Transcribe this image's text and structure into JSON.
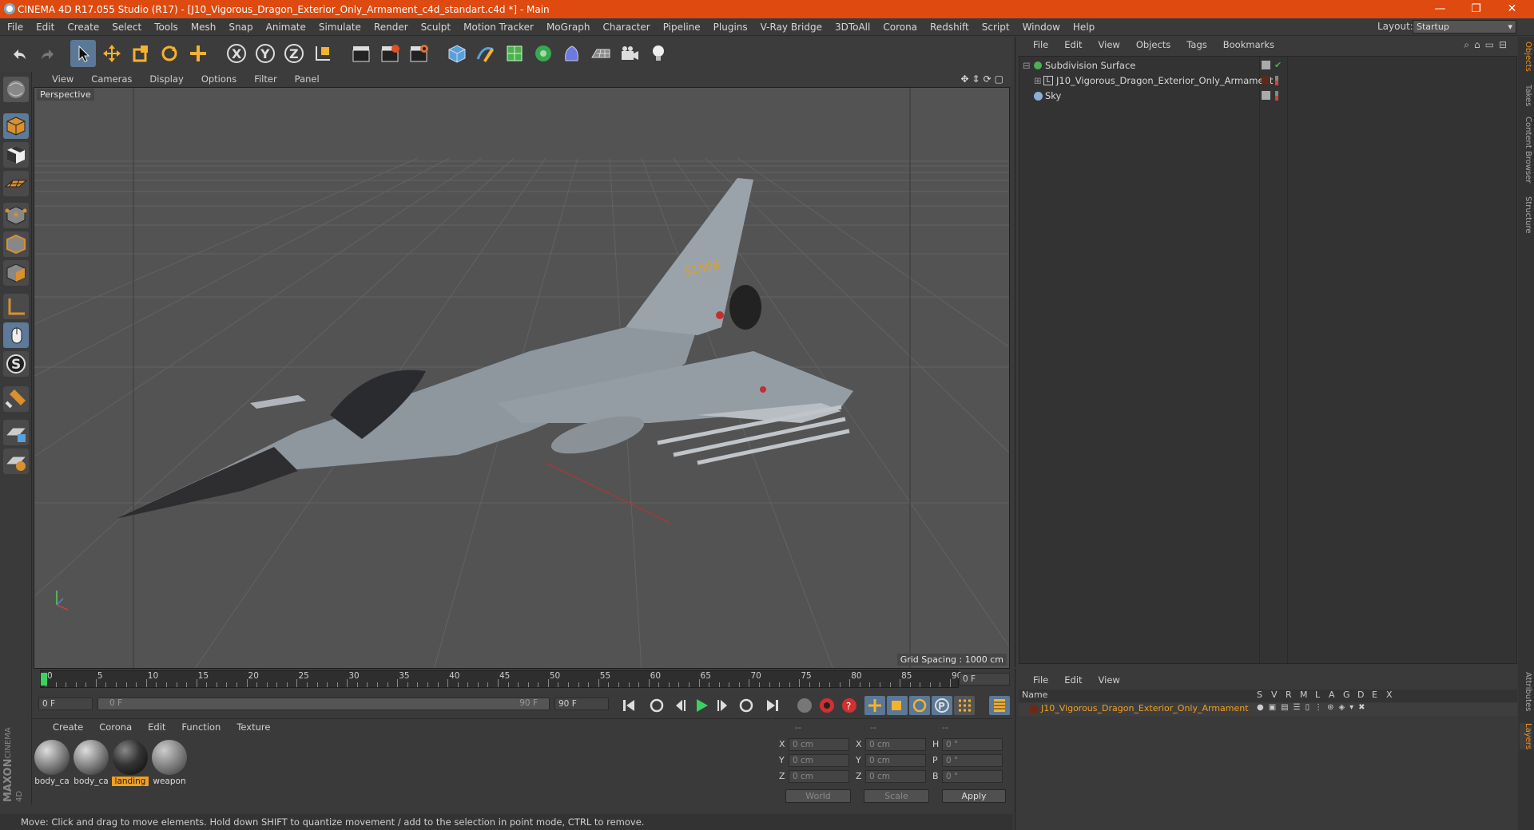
{
  "window": {
    "title": "CINEMA 4D R17.055 Studio (R17) - [J10_Vigorous_Dragon_Exterior_Only_Armament_c4d_standart.c4d *] - Main",
    "controls": [
      "—",
      "❐",
      "✕"
    ]
  },
  "menu": [
    "File",
    "Edit",
    "Create",
    "Select",
    "Tools",
    "Mesh",
    "Snap",
    "Animate",
    "Simulate",
    "Render",
    "Sculpt",
    "Motion Tracker",
    "MoGraph",
    "Character",
    "Pipeline",
    "Plugins",
    "V-Ray Bridge",
    "3DToAll",
    "Corona",
    "Redshift",
    "Script",
    "Window",
    "Help"
  ],
  "layout": {
    "label": "Layout:",
    "value": "Startup"
  },
  "viewport": {
    "menu": [
      "View",
      "Cameras",
      "Display",
      "Options",
      "Filter",
      "Panel"
    ],
    "camera_label": "Perspective",
    "grid_spacing": "Grid Spacing : 1000 cm",
    "tail_number": "51508"
  },
  "timeline": {
    "ticks": [
      "0",
      "5",
      "10",
      "15",
      "20",
      "25",
      "30",
      "35",
      "40",
      "45",
      "50",
      "55",
      "60",
      "65",
      "70",
      "75",
      "80",
      "85",
      "90"
    ],
    "current_frame": "0 F",
    "start": "0 F",
    "range_start": "0 F",
    "range_end": "90 F",
    "end": "90 F"
  },
  "materials": {
    "menu": [
      "Create",
      "Corona",
      "Edit",
      "Function",
      "Texture"
    ],
    "items": [
      {
        "name": "body_ca",
        "selected": false
      },
      {
        "name": "body_ca",
        "selected": false
      },
      {
        "name": "landing",
        "selected": true
      },
      {
        "name": "weapon",
        "selected": false
      }
    ]
  },
  "coords": {
    "headers": [
      "--",
      "--",
      "--"
    ],
    "rows": [
      {
        "a": "X",
        "av": "0 cm",
        "b": "X",
        "bv": "0 cm",
        "c": "H",
        "cv": "0 °"
      },
      {
        "a": "Y",
        "av": "0 cm",
        "b": "Y",
        "bv": "0 cm",
        "c": "P",
        "cv": "0 °"
      },
      {
        "a": "Z",
        "av": "0 cm",
        "b": "Z",
        "bv": "0 cm",
        "c": "B",
        "cv": "0 °"
      }
    ],
    "mode1": "World",
    "mode2": "Scale",
    "apply": "Apply"
  },
  "objects": {
    "menu": [
      "File",
      "Edit",
      "View",
      "Objects",
      "Tags",
      "Bookmarks"
    ],
    "items": [
      {
        "name": "Subdivision Surface"
      },
      {
        "name": "J10_Vigorous_Dragon_Exterior_Only_Armament"
      },
      {
        "name": "Sky"
      }
    ]
  },
  "layers": {
    "menu": [
      "File",
      "Edit",
      "View"
    ],
    "columns": [
      "Name",
      "S",
      "V",
      "R",
      "M",
      "L",
      "A",
      "G",
      "D",
      "E",
      "X"
    ],
    "items": [
      {
        "name": "J10_Vigorous_Dragon_Exterior_Only_Armament"
      }
    ]
  },
  "right_tabs": [
    "Objects",
    "Takes",
    "Content Browser",
    "Structure",
    "Attributes",
    "Layers"
  ],
  "brand": {
    "maxon": "MAXON",
    "product": "CINEMA 4D"
  },
  "status": "Move: Click and drag to move elements. Hold down SHIFT to quantize movement / add to the selection in point mode, CTRL to remove.",
  "colors": {
    "title_bar": "#de4a0f",
    "accent": "#f09020",
    "viewport_bg": "#535353"
  }
}
